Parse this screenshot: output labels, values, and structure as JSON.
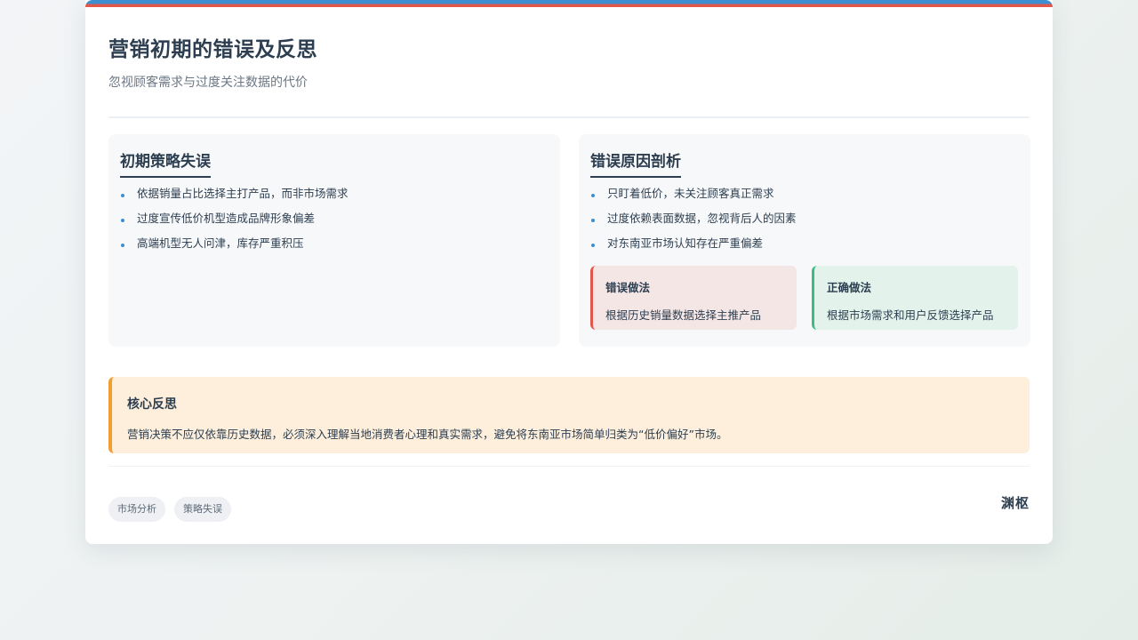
{
  "header": {
    "title": "营销初期的错误及反思",
    "subtitle": "忽视顾客需求与过度关注数据的代价"
  },
  "left_panel": {
    "title": "初期策略失误",
    "items": [
      "依据销量占比选择主打产品，而非市场需求",
      "过度宣传低价机型造成品牌形象偏差",
      "高端机型无人问津，库存严重积压"
    ]
  },
  "right_panel": {
    "title": "错误原因剖析",
    "items": [
      "只盯着低价，未关注顾客真正需求",
      "过度依赖表面数据，忽视背后人的因素",
      "对东南亚市场认知存在严重偏差"
    ],
    "wrong": {
      "title": "错误做法",
      "text": "根据历史销量数据选择主推产品"
    },
    "right": {
      "title": "正确做法",
      "text": "根据市场需求和用户反馈选择产品"
    }
  },
  "reflection": {
    "title": "核心反思",
    "text": "营销决策不应仅依靠历史数据，必须深入理解当地消费者心理和真实需求，避免将东南亚市场简单归类为“低价偏好”市场。"
  },
  "footer": {
    "tags": [
      "市场分析",
      "策略失误"
    ],
    "brand": "渊枢"
  },
  "colors": {
    "accent_blue": "#3d8fd1",
    "accent_red": "#e3574b",
    "accent_green": "#3dbd7d",
    "accent_orange": "#f0a030"
  }
}
